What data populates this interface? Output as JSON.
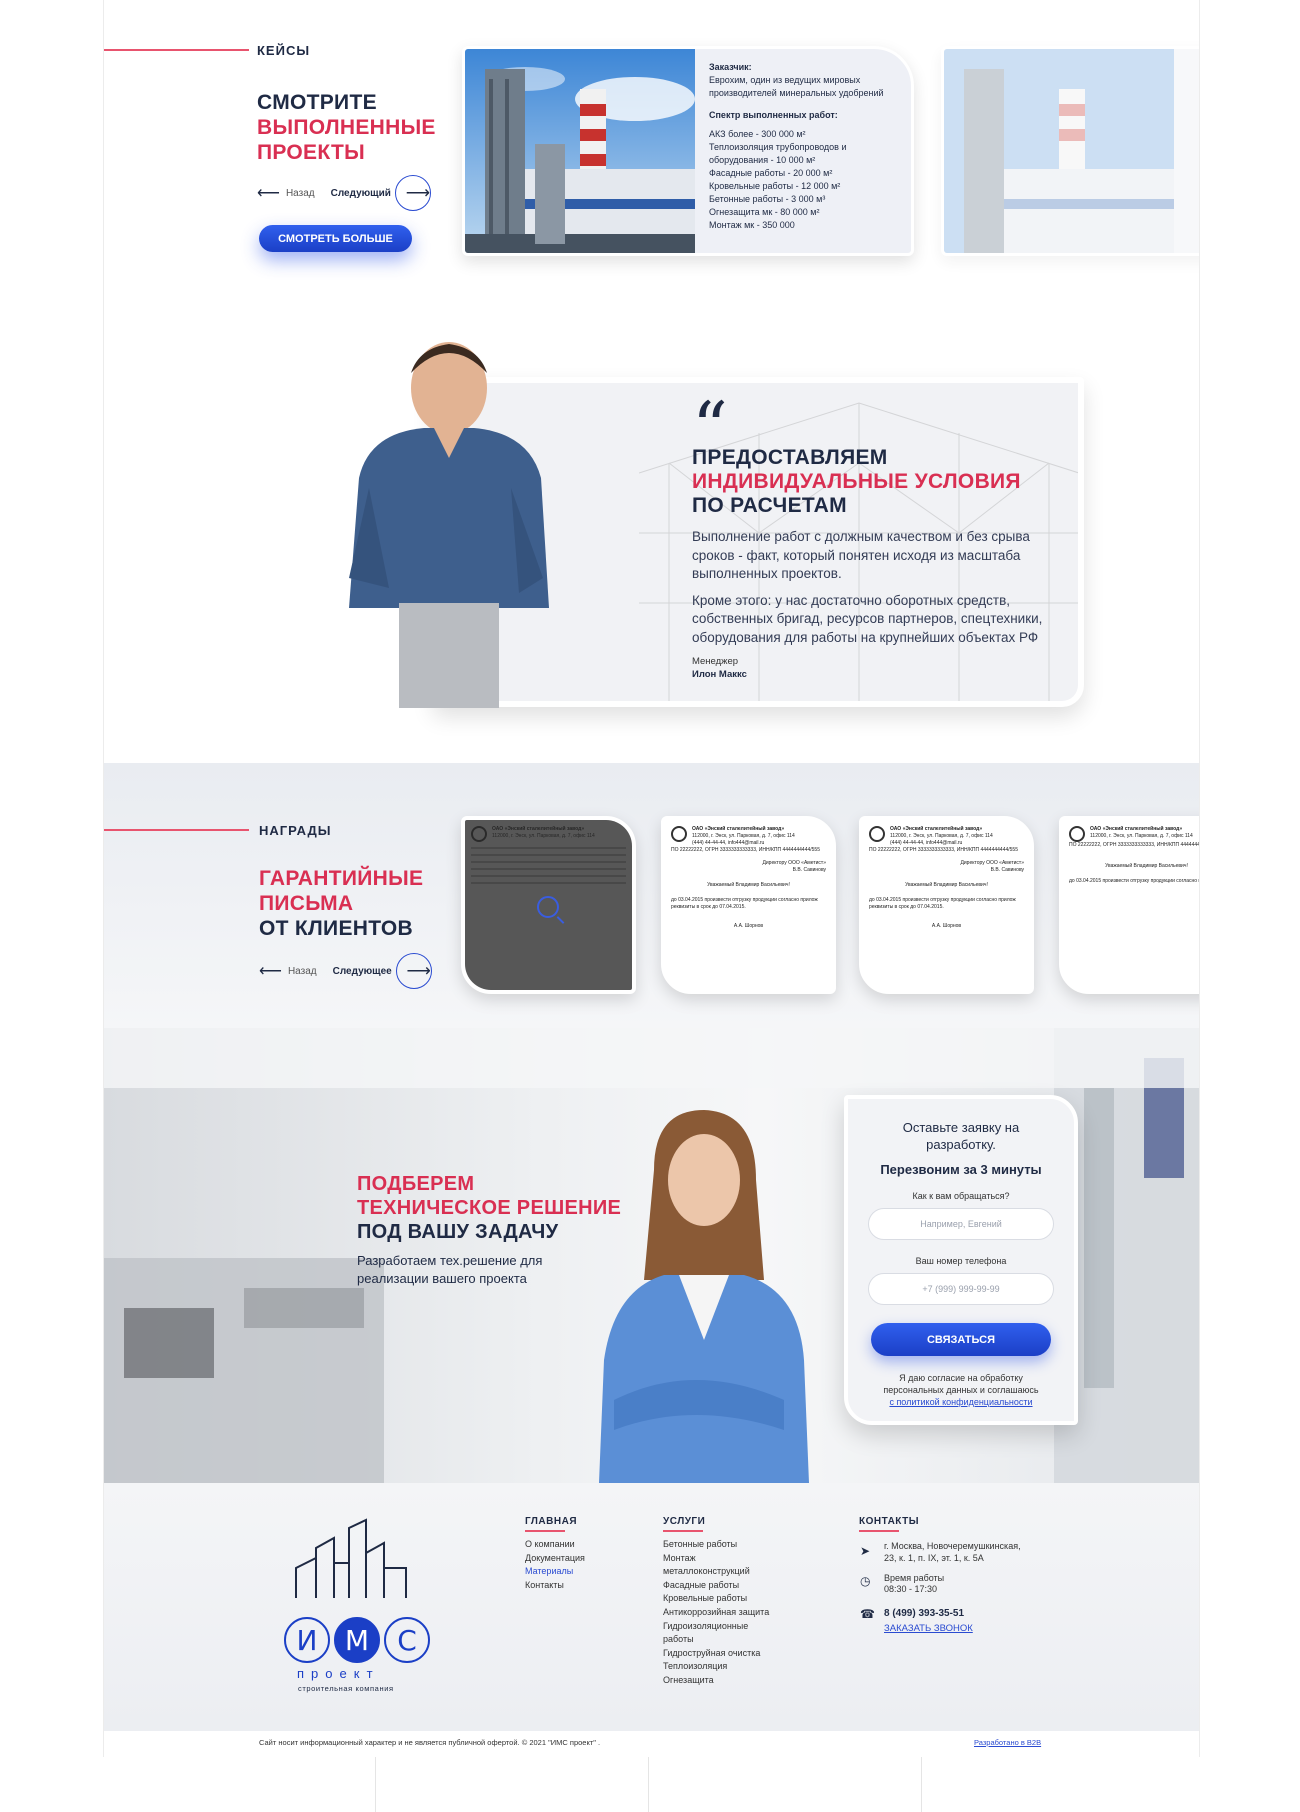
{
  "cases": {
    "label": "КЕЙСЫ",
    "title_line1": "СМОТРИТЕ",
    "title_line2": "ВЫПОЛНЕННЫЕ",
    "title_line3": "ПРОЕКТЫ",
    "nav_back": "Назад",
    "nav_next": "Следующий",
    "more_button": "СМОТРЕТЬ БОЛЬШЕ",
    "card": {
      "customer_label": "Заказчик:",
      "customer": "Еврохим, один из ведущих мировых производителей минеральных удобрений",
      "works_label": "Спектр выполненных работ:",
      "works": [
        "АКЗ более - 300 000 м²",
        "Теплоизоляция трубопроводов и оборудования - 10 000 м²",
        "Фасадные работы - 20 000 м²",
        "Кровельные работы - 12 000 м²",
        "Бетонные работы - 3 000 м³",
        "Огнезащита мк - 80 000 м²",
        "Монтаж мк - 350 000"
      ]
    }
  },
  "quote": {
    "mark": "“",
    "title_line1": "ПРЕДОСТАВЛЯЕМ",
    "title_line2": "ИНДИВИДУАЛЬНЫЕ УСЛОВИЯ",
    "title_line3": "ПО РАСЧЕТАМ",
    "paragraph1": "Выполнение работ с должным качеством и без срыва сроков - факт, который понятен исходя из масштаба выполненных проектов.",
    "paragraph2": "Кроме этого: у нас достаточно оборотных средств, собственных бригад, ресурсов партнеров, спецтехники, оборудования для работы на крупнейших объектах РФ",
    "role": "Менеджер",
    "name": "Илон Маккс"
  },
  "awards": {
    "label": "НАГРАДЫ",
    "title_line1": "ГАРАНТИЙНЫЕ",
    "title_line2": "ПИСЬМА",
    "title_line3": "ОТ КЛИЕНТОВ",
    "nav_back": "Назад",
    "nav_next": "Следующее",
    "letter": {
      "org": "ОАО «Энский сталелитейный завод»",
      "address": "112000, г. Энск, ул. Парковая, д. 7, офис 114",
      "phone": "(444) 44-44-44, info444@mail.ru",
      "ids": "ПО 22222222, ОГРН 3333333333333, ИНН/КПП 4444444444/555",
      "to": "Директору ООО «Аметист»",
      "to_name": "В.В. Савинову",
      "salutation": "Уважаемый Владимир Васильевич!",
      "body": "до 03.04.2015 произвести отгрузку продукции согласно прилож",
      "body2": "реквизиты в срок до 07.04.2015.",
      "sign": "А.А. Шорнов"
    }
  },
  "lead": {
    "title_line1": "ПОДБЕРЕМ",
    "title_line2": "ТЕХНИЧЕСКОЕ РЕШЕНИЕ",
    "title_line3": "ПОД ВАШУ ЗАДАЧУ",
    "subtitle": "Разработаем тех.решение для реализации вашего проекта",
    "form": {
      "title": "Оставьте заявку на разработку.",
      "title_bold": "Перезвоним за 3 минуты",
      "name_label": "Как к вам обращаться?",
      "name_placeholder": "Например, Евгений",
      "phone_label": "Ваш номер телефона",
      "phone_placeholder": "+7 (999) 999-99-99",
      "submit": "СВЯЗАТЬСЯ",
      "agree_text": "Я даю согласие на обработку персональных данных и соглашаюсь",
      "agree_link": "с политикой конфиденциальности"
    }
  },
  "footer": {
    "logo_letters": [
      "И",
      "М",
      "С"
    ],
    "logo_sub1": "проект",
    "logo_sub2": "строительная компания",
    "main_title": "ГЛАВНАЯ",
    "main_items": [
      "О компании",
      "Документация",
      "Материалы",
      "Контакты"
    ],
    "services_title": "УСЛУГИ",
    "services_items": [
      "Бетонные работы",
      "Монтаж",
      "металлоконструкций",
      "Фасадные работы",
      "Кровельные работы",
      "Антикоррозийная защита",
      "Гидроизоляционные",
      "работы",
      "Гидроструйная очистка",
      "Теплоизоляция",
      "Огнезащита"
    ],
    "contacts_title": "КОНТАКТЫ",
    "address": "г. Москва, Новочеремушкинская, 23, к. 1, п. IX, эт. 1, к. 5А",
    "hours_label": "Время работы",
    "hours": "08:30 - 17:30",
    "phone": "8 (499) 393-35-51",
    "call_link": "ЗАКАЗАТЬ ЗВОНОК",
    "copyright": "Сайт носит информационный характер и не является публичной офертой. © 2021 \"ИМС проект\" .",
    "developer": "Разработано в B2B"
  },
  "colors": {
    "accent_red": "#d92f52",
    "brand_blue": "#1b3fc6",
    "dark_text": "#1f2a44"
  }
}
